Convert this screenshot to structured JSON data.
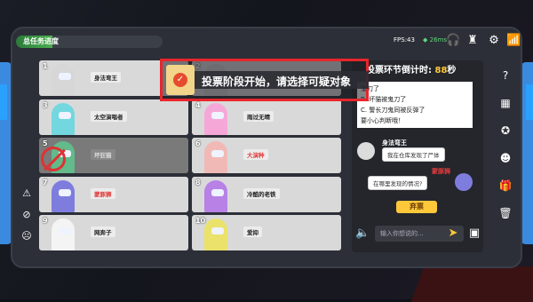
{
  "top": {
    "task_label": "总任务进度",
    "task_progress": 0.25,
    "fps": "FPS:43",
    "ping": "26ms"
  },
  "players": [
    {
      "num": "1",
      "name": "身法弯王",
      "color": "#d7d7d7",
      "alive": true,
      "name_red": false
    },
    {
      "num": "2",
      "name": "",
      "color": "#cfcfcf",
      "alive": true,
      "name_red": false
    },
    {
      "num": "3",
      "name": "太空演唱者",
      "color": "#72d7df",
      "alive": true,
      "name_red": false
    },
    {
      "num": "4",
      "name": "雨过无晴",
      "color": "#f5a8d8",
      "alive": true,
      "name_red": false
    },
    {
      "num": "5",
      "name": "坏狂猫",
      "color": "#63ba8a",
      "alive": false,
      "name_red": false
    },
    {
      "num": "6",
      "name": "大演种",
      "color": "#f1b9b6",
      "alive": true,
      "name_red": true
    },
    {
      "num": "7",
      "name": "蒙豚狮",
      "color": "#7e7dde",
      "alive": true,
      "name_red": true
    },
    {
      "num": "8",
      "name": "冷酷的老铁",
      "color": "#b781e6",
      "alive": true,
      "name_red": false
    },
    {
      "num": "9",
      "name": "网奔子",
      "color": "#f4f4f4",
      "alive": true,
      "name_red": false
    },
    {
      "num": "10",
      "name": "爱抑",
      "color": "#eae26a",
      "alive": true,
      "name_red": false
    }
  ],
  "banner": {
    "text": "投票阶段开始，请选择可疑对象"
  },
  "chat": {
    "timer_label": "投票环节倒计时:",
    "timer_seconds": "88",
    "timer_unit": "秒",
    "log": [
      "鬼刀了",
      "B. 坏猫被鬼刀了",
      "C. 警长刀鬼同被反弹了",
      "要小心判断哦！"
    ],
    "msg1_name": "身法弯王",
    "msg1_text": "我在仓库发现了尸体",
    "msg2_name": "蒙豚狮",
    "msg2_text": "在哪里发现的情况?",
    "abstain_label": "弃票",
    "input_placeholder": "输入你想说的..."
  },
  "colors": {
    "accent": "#3a8be0",
    "red": "#e8262b",
    "yellow": "#ffc83a"
  },
  "icons": {
    "left": [
      "report-icon",
      "block-icon",
      "emote-icon"
    ],
    "right": [
      "help-icon",
      "map-icon",
      "medal-icon",
      "emoji-icon",
      "gift-icon",
      "bin-icon"
    ],
    "top": [
      "headset-icon",
      "leaderboard-icon",
      "gear-icon",
      "wifi-icon"
    ]
  }
}
